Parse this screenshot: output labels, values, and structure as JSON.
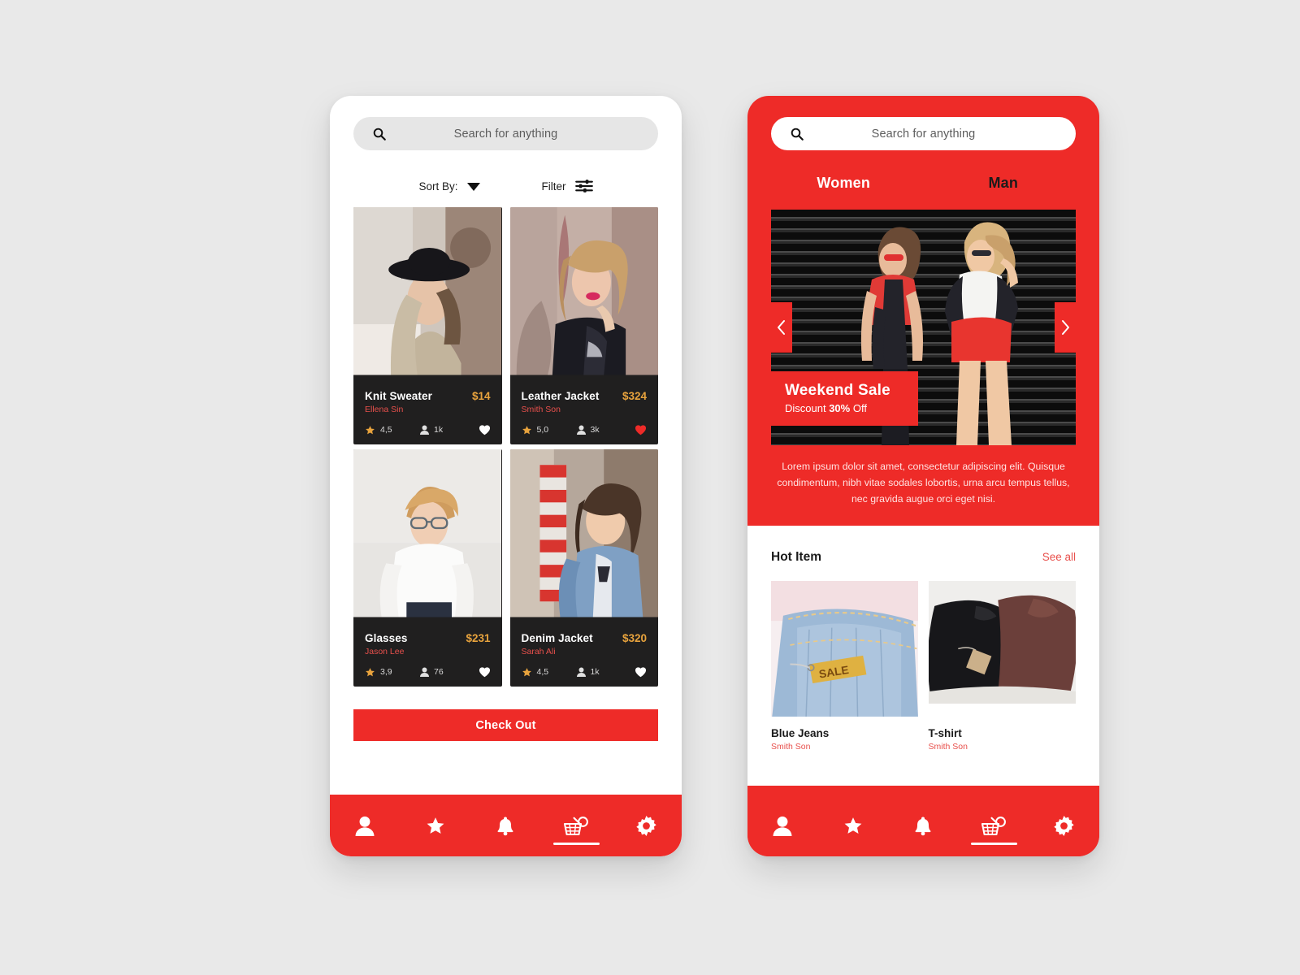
{
  "brand": {
    "red": "#EE2B28",
    "gold": "#E8A33D",
    "card_dark": "#201F1F",
    "seller_red": "#E8504C"
  },
  "left_phone": {
    "search": {
      "placeholder": "Search for anything",
      "icon": "search-icon"
    },
    "sort": {
      "label": "Sort By:",
      "icon": "chevron-down-icon"
    },
    "filter": {
      "label": "Filter",
      "icon": "filter-sliders-icon"
    },
    "products": [
      {
        "title": "Knit Sweater",
        "price": "$14",
        "seller": "Ellena Sin",
        "rating": "4,5",
        "views": "1k",
        "liked": false
      },
      {
        "title": "Leather Jacket",
        "price": "$324",
        "seller": "Smith Son",
        "rating": "5,0",
        "views": "3k",
        "liked": true
      },
      {
        "title": "Glasses",
        "price": "$231",
        "seller": "Jason Lee",
        "rating": "3,9",
        "views": "76",
        "liked": false
      },
      {
        "title": "Denim Jacket",
        "price": "$320",
        "seller": "Sarah Ali",
        "rating": "4,5",
        "views": "1k",
        "liked": false
      }
    ],
    "checkout_label": "Check Out"
  },
  "right_phone": {
    "search": {
      "placeholder": "Search for anything",
      "icon": "search-icon"
    },
    "tabs": [
      {
        "label": "Women",
        "active": true
      },
      {
        "label": "Man",
        "active": false
      }
    ],
    "banner": {
      "title": "Weekend Sale",
      "subtitle_prefix": "Discount ",
      "subtitle_strong": "30%",
      "subtitle_suffix": " Off",
      "prev_icon": "chevron-left-icon",
      "next_icon": "chevron-right-icon"
    },
    "description": "Lorem ipsum dolor sit amet, consectetur adipiscing elit. Quisque condimentum, nibh vitae sodales lobortis, urna arcu tempus tellus, nec gravida augue orci eget nisi.",
    "hot_section": {
      "title": "Hot Item",
      "see_all": "See all"
    },
    "hot_items": [
      {
        "name": "Blue Jeans",
        "seller": "Smith Son",
        "tag": "SALE"
      },
      {
        "name": "T-shirt",
        "seller": "Smith Son",
        "tag": ""
      }
    ]
  },
  "tabbar": [
    {
      "name": "profile",
      "icon": "person-icon",
      "active": false
    },
    {
      "name": "favorites",
      "icon": "star-icon",
      "active": false
    },
    {
      "name": "notifications",
      "icon": "bell-icon",
      "active": false
    },
    {
      "name": "cart",
      "icon": "basket-icon",
      "active": true
    },
    {
      "name": "settings",
      "icon": "gear-icon",
      "active": false
    }
  ]
}
